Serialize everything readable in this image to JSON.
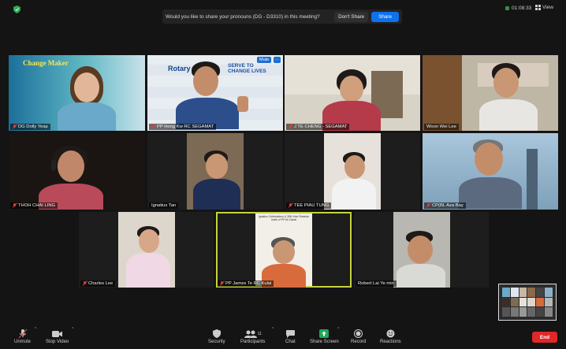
{
  "topbar": {
    "notice": "Would you like to share your pronouns (DG - D3310) in this meeting?",
    "dont_share": "Don't Share",
    "share": "Share",
    "timer": "01:08:33",
    "view": "View"
  },
  "tiles": [
    {
      "name": "DG Dolly Yeap",
      "muted": true,
      "banner": "Change Maker"
    },
    {
      "name": "PP Hong Kw RC SEGAMAT",
      "muted": true,
      "mute_tag": "Mute",
      "banner": "SERVE TO CHANGE LIVES",
      "brand": "Rotary"
    },
    {
      "name": "J TE CHENG - SEGAMAT",
      "muted": true
    },
    {
      "name": "Woon Wei Lee",
      "muted": false
    },
    {
      "name": "THOH CHAI LING",
      "muted": true
    },
    {
      "name": "Ignatius Tan",
      "muted": false
    },
    {
      "name": "TEE PIAU TUNG",
      "muted": true
    },
    {
      "name": "CP(BL Aza Bay",
      "muted": true
    },
    {
      "name": "Charles Lee",
      "muted": true
    },
    {
      "name": "PP James Te RC Kulai",
      "muted": true,
      "banner": "Ignatius Celebrations & 35th Year Rotarian Invite of PP Ali Zainal"
    },
    {
      "name": "Robert Lai Ye min",
      "muted": false
    }
  ],
  "toolbar": {
    "unmute": "Unmute",
    "stop_video": "Stop Video",
    "security": "Security",
    "participants": "Participants",
    "participants_count": "11",
    "chat": "Chat",
    "share_screen": "Share Screen",
    "record": "Record",
    "reactions": "Reactions",
    "end": "End"
  },
  "colors": {
    "accent": "#0e72ed",
    "end": "#e02828",
    "share_screen": "#23a55a",
    "active_speaker": "#c5d33c"
  }
}
